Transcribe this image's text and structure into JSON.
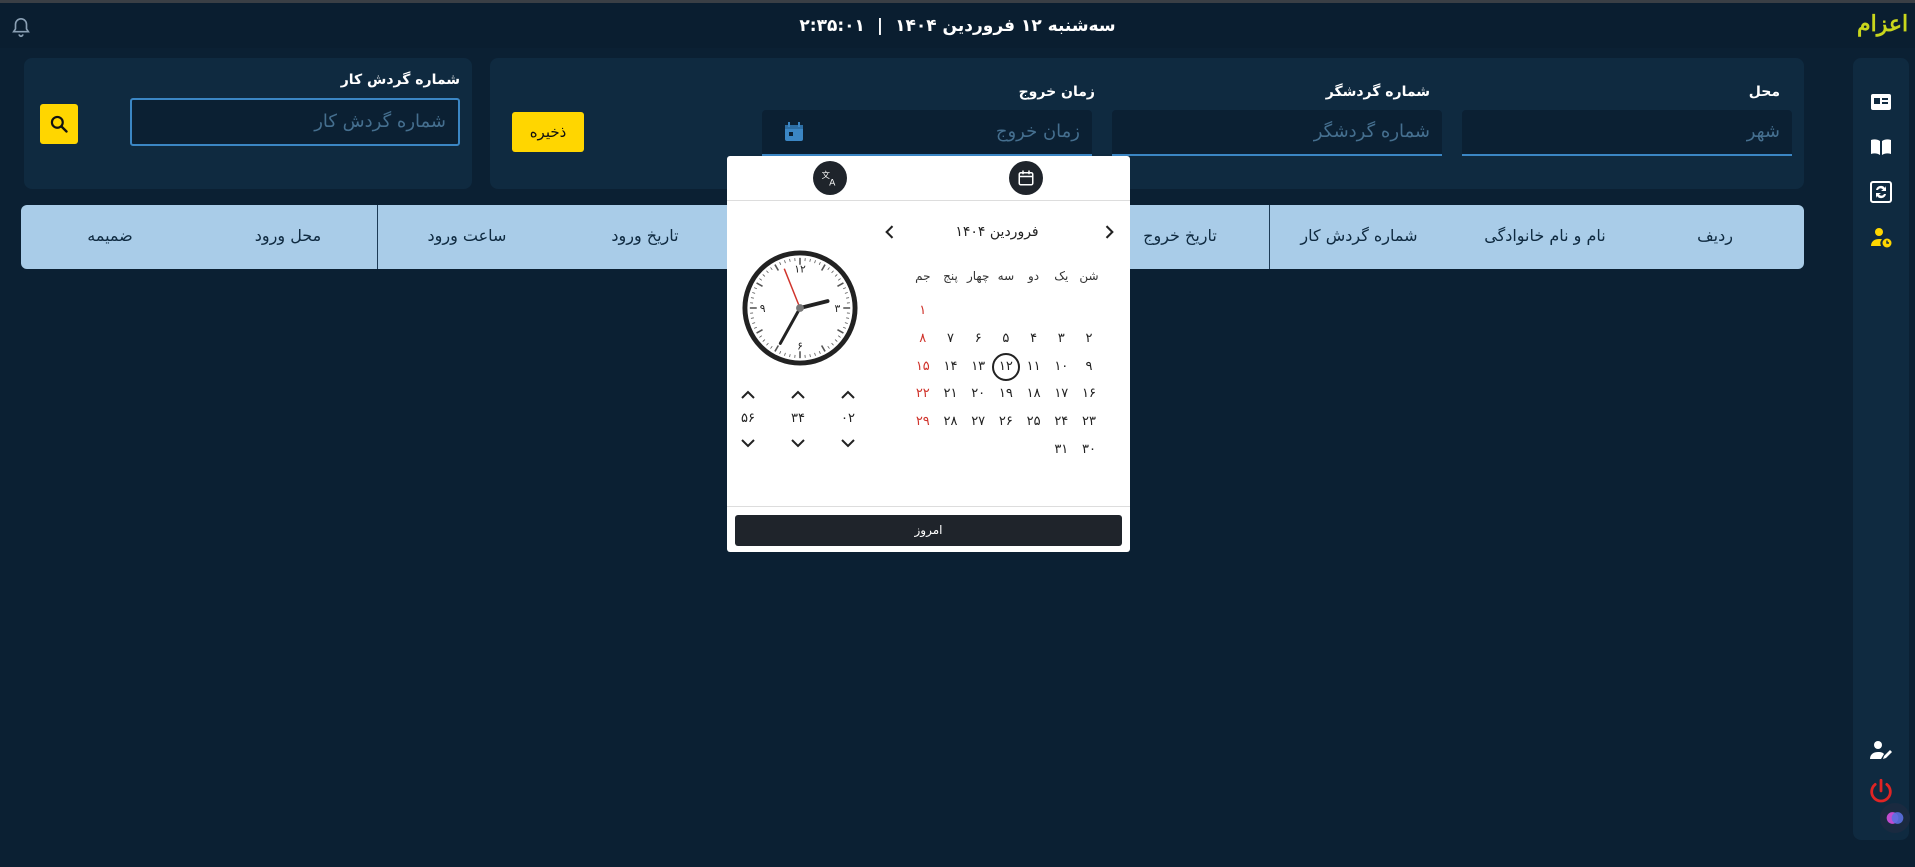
{
  "topbar": {
    "time": "۲:۳۵:۰۱",
    "date": "سه‌شنبه ۱۲ فروردین ۱۴۰۴",
    "separator": "|"
  },
  "form": {
    "location_label": "محل",
    "location_placeholder": "شهر",
    "tourist_label": "شماره گردشگر",
    "tourist_placeholder": "شماره گردشگر",
    "exit_label": "زمان خروج",
    "exit_placeholder": "زمان خروج",
    "save_label": "ذخیره"
  },
  "search": {
    "label": "شماره گردش کار",
    "placeholder": "شماره گردش کار"
  },
  "table": {
    "columns": [
      "ردیف",
      "نام و نام خانوادگی",
      "شماره گردش کار",
      "تاریخ خروج",
      "تاریخ ورود",
      "ساعت ورود",
      "محل ورود",
      "ضمیمه"
    ]
  },
  "datepicker": {
    "month_title": "فروردین ۱۴۰۴",
    "weekdays": [
      "شن",
      "یک",
      "دو",
      "سه",
      "چهار",
      "پنج",
      "جم"
    ],
    "weeks": [
      [
        "",
        "",
        "",
        "",
        "",
        "",
        "۱"
      ],
      [
        "۲",
        "۳",
        "۴",
        "۵",
        "۶",
        "۷",
        "۸"
      ],
      [
        "۹",
        "۱۰",
        "۱۱",
        "۱۲",
        "۱۳",
        "۱۴",
        "۱۵"
      ],
      [
        "۱۶",
        "۱۷",
        "۱۸",
        "۱۹",
        "۲۰",
        "۲۱",
        "۲۲"
      ],
      [
        "۲۳",
        "۲۴",
        "۲۵",
        "۲۶",
        "۲۷",
        "۲۸",
        "۲۹"
      ],
      [
        "۳۰",
        "۳۱",
        "",
        "",
        "",
        "",
        ""
      ]
    ],
    "selected_day": "۱۲",
    "clock_numbers": {
      "twelve": "۱۲",
      "three": "۳",
      "six": "۶",
      "nine": "۹"
    },
    "time_values": {
      "hour": "۰۲",
      "minute": "۳۴",
      "second": "۵۶"
    },
    "today_label": "امروز"
  },
  "logo_text": "اعزام",
  "colors": {
    "background": "#0b2033",
    "panel": "#0f2a40",
    "accent": "#ffd600",
    "table_header": "#a9cce8",
    "friday": "#d0342c"
  },
  "icons": [
    "bell-icon",
    "id-card-icon",
    "book-icon",
    "sync-icon",
    "user-clock-icon",
    "user-edit-icon",
    "power-icon",
    "search-icon",
    "calendar-icon",
    "translate-icon",
    "chevron-left-icon",
    "chevron-right-icon"
  ]
}
